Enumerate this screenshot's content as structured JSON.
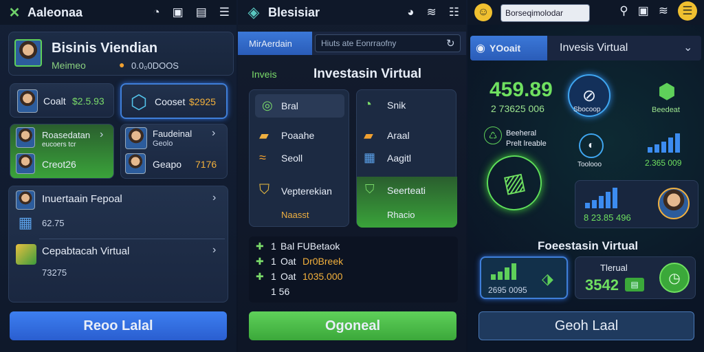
{
  "panel1": {
    "title": "Aaleonaa",
    "profile": {
      "name": "Bisinis Viendian",
      "sub": "Meimeo",
      "coin": "0.0₀0DOOS"
    },
    "tile_a": {
      "label": "Coalt",
      "value": "$2.5.93"
    },
    "tile_b": {
      "label": "Cooset",
      "value": "$2925"
    },
    "tile_c": {
      "line1": "Roasedatan",
      "line2": "eucoers tcr",
      "value": "Creot26"
    },
    "tile_d": {
      "line1": "Faudeinal",
      "line2": "Geolo",
      "label": "Geapo",
      "value": "7176"
    },
    "list": [
      {
        "title": "Inuertaain Fepoal",
        "value": "62.75"
      },
      {
        "title": "Cepabtacah Virtual",
        "value": "73275"
      }
    ],
    "button": "Reoo Lalal"
  },
  "panel2": {
    "title": "Blesisiar",
    "tab_active": "MirAerdain",
    "search_text": "Hiuts ate Eonrraofny",
    "section_label": "Inveis",
    "section_title": "Investasin Virtual",
    "left_items": [
      "Bral",
      "Poaahe",
      "Seoll",
      "Vepterekian"
    ],
    "left_footer": "Naasst",
    "right_items": [
      "Snik",
      "Araal",
      "Aagitl",
      "Seerteati"
    ],
    "right_footer": "Rhacio",
    "tx": [
      {
        "qty": "1",
        "text": "Bal FUBetaok"
      },
      {
        "qty": "1",
        "text": "Oat",
        "accent": "Dr0Breek"
      },
      {
        "qty": "1",
        "text": "Oat",
        "accent": "1035.000"
      },
      {
        "qty": "",
        "text": "1 56"
      }
    ],
    "button": "Ogoneal"
  },
  "panel3": {
    "search_text": "Borseqimolodar",
    "tab_active": "YOoait",
    "tab_title": "Invesis Virtual",
    "big_value": "459.89",
    "big_sub": "2 73625 006",
    "node1": "Sbocoop",
    "node2": "Beedeat",
    "node3_line1": "Beeheral",
    "node3_line2": "Prelt lreable",
    "node4": "Toolooo",
    "node5_value": "2.365 009",
    "card_value": "8 23.85 496",
    "section_title": "Foeestasin Virtual",
    "bottom_a": "2695 0095",
    "bottom_b_title": "Tlerual",
    "bottom_b_value": "3542",
    "button": "Geoh Laal"
  }
}
